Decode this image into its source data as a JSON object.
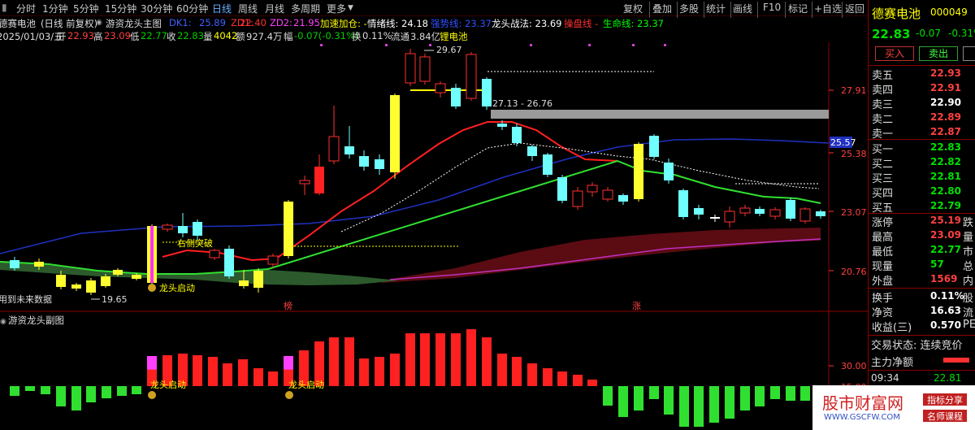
{
  "toolbar": {
    "periods": [
      "分时",
      "1分钟",
      "5分钟",
      "15分钟",
      "30分钟",
      "60分钟",
      "日线",
      "周线",
      "月线",
      "多周期",
      "更多"
    ],
    "active_period": "日线",
    "buttons": [
      "复权",
      "叠加",
      "多股",
      "统计",
      "画线",
      "F10",
      "标记",
      "+自选",
      "返回"
    ]
  },
  "header": {
    "stock_name": "德赛电池",
    "mode": "(日线 前复权)",
    "indicator": "游资龙头主图",
    "dk1_label": "DK1:",
    "dk1": "25.89",
    "zd1_label": "ZD1:",
    "zd1": "22.40",
    "zd2_label": "ZD2:",
    "zd2": "21.95",
    "jiasu": "加速加仓: -",
    "qingxu": "情绪线: 24.18",
    "qiangshi": "强势线: 23.37",
    "longtou": "龙头战法: 23.69",
    "caopan": "操盘线 -",
    "shengming": "生命线: 23.37"
  },
  "quote": {
    "date": "2025/01/03/五",
    "open_label": "开",
    "open": "22.93",
    "high_label": "高",
    "high": "23.09",
    "low_label": "低",
    "low": "22.77",
    "close_label": "收",
    "close": "22.83",
    "vol_label": "量",
    "vol": "4042",
    "amt_label": "额",
    "amt": "927.4万",
    "chg_label": "幅",
    "chg": "-0.07(-0.31%)",
    "turn_label": "换",
    "turn": "0.11%",
    "float_label": "流通",
    "float": "3.84亿",
    "concept": "锂电池"
  },
  "chart_labels": {
    "peak": "29.67",
    "low": "19.65",
    "range": "27.13 - 26.76",
    "right_break": "右侧突破",
    "start1": "龙头启动",
    "future": "用到未来数据",
    "bang": "榜",
    "zhang": "涨",
    "price_tag": "25.57"
  },
  "price_axis": [
    "27.91",
    "25.38",
    "23.07",
    "20.76"
  ],
  "sub_chart": {
    "title": "游资龙头副图",
    "start_label": "龙头启动",
    "axis": [
      "30.00",
      "15.00"
    ]
  },
  "side": {
    "name": "德赛电池",
    "code": "000049",
    "price": "22.83",
    "change": "-0.07",
    "pct": "-0.31%",
    "buy_btn": "买入",
    "sell_btn": "卖出",
    "asks": [
      {
        "label": "卖五",
        "price": "22.93"
      },
      {
        "label": "卖四",
        "price": "22.91"
      },
      {
        "label": "卖三",
        "price": "22.90"
      },
      {
        "label": "卖二",
        "price": "22.89"
      },
      {
        "label": "卖一",
        "price": "22.87"
      }
    ],
    "bids": [
      {
        "label": "买一",
        "price": "22.83"
      },
      {
        "label": "买二",
        "price": "22.82"
      },
      {
        "label": "买三",
        "price": "22.81"
      },
      {
        "label": "买四",
        "price": "22.80"
      },
      {
        "label": "买五",
        "price": "22.79"
      }
    ],
    "stats": [
      {
        "label": "涨停",
        "value": "25.19",
        "tail": "跌"
      },
      {
        "label": "最高",
        "value": "23.09",
        "tail": "量"
      },
      {
        "label": "最低",
        "value": "22.77",
        "tail": "市"
      },
      {
        "label": "现量",
        "value": "57",
        "tail": "总"
      },
      {
        "label": "外盘",
        "value": "1569",
        "tail": "内"
      }
    ],
    "stats2": [
      {
        "label": "换手",
        "value": "0.11%",
        "tail": "股"
      },
      {
        "label": "净资",
        "value": "16.63",
        "tail": "流"
      },
      {
        "label": "收益(三)",
        "value": "0.570",
        "tail": "PE"
      }
    ],
    "trade_status": "交易状态: 连续竞价",
    "main_net": "主力净额",
    "time": "09:34",
    "tick_price": "22.81"
  },
  "watermark": {
    "title": "股市财富网",
    "url": "WWW.GSCFW.COM",
    "tag1": "指标分享",
    "tag2": "名师课程"
  }
}
